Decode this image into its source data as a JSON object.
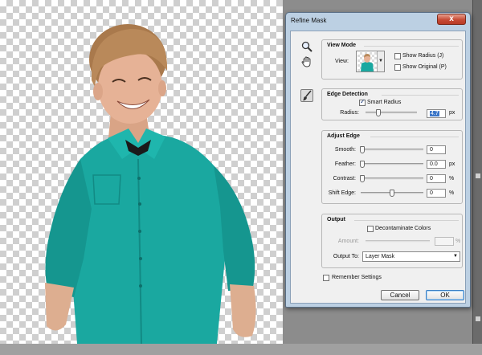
{
  "dialog": {
    "title": "Refine Mask",
    "close_glyph": "x"
  },
  "tools": {
    "zoom": "zoom-icon",
    "hand": "hand-icon",
    "refine_brush": "refine-radius-brush-icon"
  },
  "view_mode": {
    "heading": "View Mode",
    "view_label": "View:",
    "show_radius": {
      "label": "Show Radius (J)",
      "checked": false
    },
    "show_original": {
      "label": "Show Original (P)",
      "checked": false
    }
  },
  "edge_detection": {
    "heading": "Edge Detection",
    "smart_radius": {
      "label": "Smart Radius",
      "checked": true
    },
    "radius": {
      "label": "Radius:",
      "value": "4.7",
      "unit": "px"
    }
  },
  "adjust_edge": {
    "heading": "Adjust Edge",
    "smooth": {
      "label": "Smooth:",
      "value": "0",
      "unit": ""
    },
    "feather": {
      "label": "Feather:",
      "value": "0.0",
      "unit": "px"
    },
    "contrast": {
      "label": "Contrast:",
      "value": "0",
      "unit": "%"
    },
    "shift_edge": {
      "label": "Shift Edge:",
      "value": "0",
      "unit": "%"
    }
  },
  "output": {
    "heading": "Output",
    "decontaminate": {
      "label": "Decontaminate Colors",
      "checked": false
    },
    "amount": {
      "label": "Amount:",
      "value": "",
      "unit": "%"
    },
    "output_to": {
      "label": "Output To:",
      "value": "Layer Mask"
    }
  },
  "remember_settings": {
    "label": "Remember Settings",
    "checked": false
  },
  "buttons": {
    "cancel": "Cancel",
    "ok": "OK"
  },
  "colors": {
    "shirt": "#1aa8a0",
    "hair": "#b9895a",
    "skin": "#e6b296",
    "dialog_frame": "#bcd0e3",
    "close_red": "#c74b35"
  }
}
